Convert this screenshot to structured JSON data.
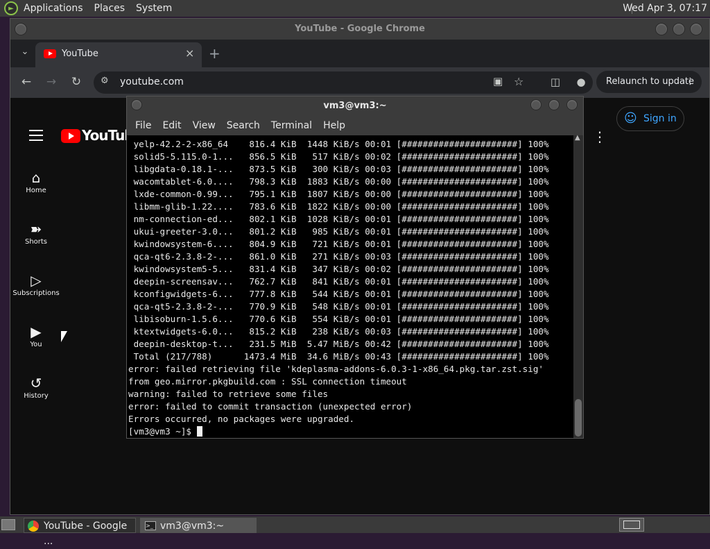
{
  "top_panel": {
    "menus": [
      "Applications",
      "Places",
      "System"
    ],
    "clock": "Wed Apr  3, 07:17"
  },
  "chrome": {
    "window_title": "YouTube - Google Chrome",
    "tab_title": "YouTube",
    "url": "youtube.com",
    "relaunch_label": "Relaunch to update"
  },
  "youtube": {
    "logo_text": "YouTube",
    "nav": [
      {
        "label": "Home",
        "icon": "home-icon"
      },
      {
        "label": "Shorts",
        "icon": "shorts-icon"
      },
      {
        "label": "Subscriptions",
        "icon": "subscriptions-icon"
      },
      {
        "label": "You",
        "icon": "you-icon"
      },
      {
        "label": "History",
        "icon": "history-icon"
      }
    ],
    "sign_in": "Sign in"
  },
  "terminal": {
    "title": "vm3@vm3:~",
    "menu": [
      "File",
      "Edit",
      "View",
      "Search",
      "Terminal",
      "Help"
    ],
    "lines": [
      " yelp-42.2-2-x86_64    816.4 KiB  1448 KiB/s 00:01 [######################] 100%",
      " solid5-5.115.0-1...   856.5 KiB   517 KiB/s 00:02 [######################] 100%",
      " libgdata-0.18.1-...   873.5 KiB   300 KiB/s 00:03 [######################] 100%",
      " wacomtablet-6.0....   798.3 KiB  1883 KiB/s 00:00 [######################] 100%",
      " lxde-common-0.99...   795.1 KiB  1807 KiB/s 00:00 [######################] 100%",
      " libmm-glib-1.22....   783.6 KiB  1822 KiB/s 00:00 [######################] 100%",
      " nm-connection-ed...   802.1 KiB  1028 KiB/s 00:01 [######################] 100%",
      " ukui-greeter-3.0...   801.2 KiB   985 KiB/s 00:01 [######################] 100%",
      " kwindowsystem-6....   804.9 KiB   721 KiB/s 00:01 [######################] 100%",
      " qca-qt6-2.3.8-2-...   861.0 KiB   271 KiB/s 00:03 [######################] 100%",
      " kwindowsystem5-5...   831.4 KiB   347 KiB/s 00:02 [######################] 100%",
      " deepin-screensav...   762.7 KiB   841 KiB/s 00:01 [######################] 100%",
      " kconfigwidgets-6...   777.8 KiB   544 KiB/s 00:01 [######################] 100%",
      " qca-qt5-2.3.8-2-...   770.9 KiB   548 KiB/s 00:01 [######################] 100%",
      " libisoburn-1.5.6...   770.6 KiB   554 KiB/s 00:01 [######################] 100%",
      " ktextwidgets-6.0...   815.2 KiB   238 KiB/s 00:03 [######################] 100%",
      " deepin-desktop-t...   231.5 MiB  5.47 MiB/s 00:42 [######################] 100%",
      " Total (217/788)      1473.4 MiB  34.6 MiB/s 00:43 [######################] 100%",
      "error: failed retrieving file 'kdeplasma-addons-6.0.3-1-x86_64.pkg.tar.zst.sig'",
      "from geo.mirror.pkgbuild.com : SSL connection timeout",
      "warning: failed to retrieve some files",
      "error: failed to commit transaction (unexpected error)",
      "Errors occurred, no packages were upgraded."
    ],
    "prompt": "[vm3@vm3 ~]$ "
  },
  "taskbar": {
    "items": [
      {
        "label": "YouTube - Google ...",
        "icon": "chrome-icon"
      },
      {
        "label": "vm3@vm3:~",
        "icon": "terminal-icon"
      }
    ]
  }
}
